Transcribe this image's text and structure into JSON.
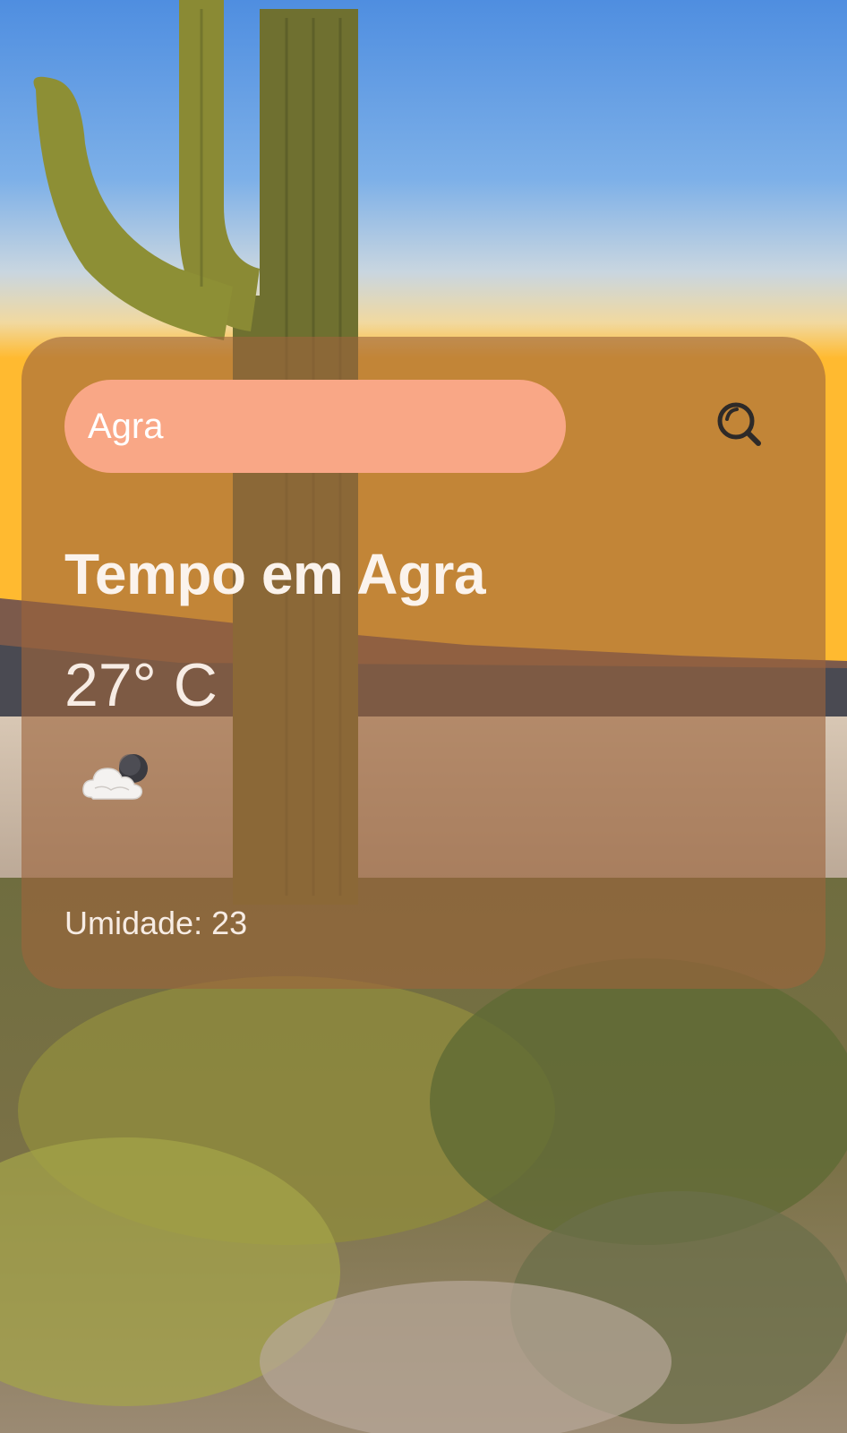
{
  "search": {
    "value": "Agra",
    "icon": "search-icon"
  },
  "weather": {
    "title": "Tempo em Agra",
    "temperature": "27° C",
    "condition_icon": "cloud-night-icon",
    "humidity": "Umidade: 23"
  },
  "colors": {
    "card": "#9c643c",
    "search_pill": "#f9a786",
    "text": "#fbf3ec",
    "search_icon": "#2e2a28"
  }
}
